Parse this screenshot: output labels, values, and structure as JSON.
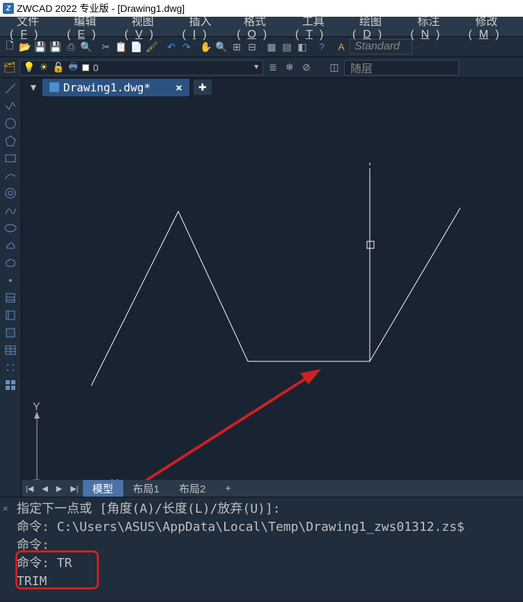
{
  "titlebar": {
    "title": "ZWCAD 2022 专业版 - [Drawing1.dwg]"
  },
  "menubar": {
    "items": [
      {
        "label": "文件",
        "key": "F"
      },
      {
        "label": "编辑",
        "key": "E"
      },
      {
        "label": "视图",
        "key": "V"
      },
      {
        "label": "插入",
        "key": "I"
      },
      {
        "label": "格式",
        "key": "O"
      },
      {
        "label": "工具",
        "key": "T"
      },
      {
        "label": "绘图",
        "key": "D"
      },
      {
        "label": "标注",
        "key": "N"
      },
      {
        "label": "修改",
        "key": "M"
      }
    ]
  },
  "toolbar": {
    "style_input": "Standard"
  },
  "layer": {
    "current_layer": "0",
    "follow_label": "随层"
  },
  "file_tab": {
    "name": "Drawing1.dwg*"
  },
  "bottom_tabs": {
    "tabs": [
      "模型",
      "布局1",
      "布局2"
    ],
    "plus": "+"
  },
  "command": {
    "line1": "指定下一点或 [角度(A)/长度(L)/放弃(U)]:",
    "line2": "命令: C:\\Users\\ASUS\\AppData\\Local\\Temp\\Drawing1_zws01312.zs$",
    "line3": "命令:",
    "line4": "命令: TR",
    "line5": "TRIM"
  },
  "axis": {
    "x": "X",
    "y": "Y"
  }
}
